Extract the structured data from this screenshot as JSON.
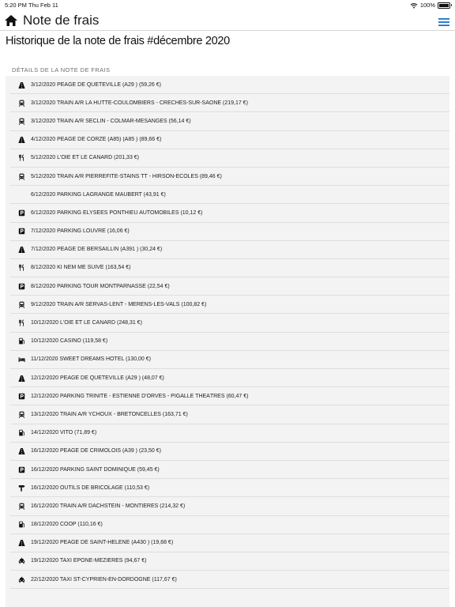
{
  "status": {
    "time": "5:20 PM",
    "date": "Thu Feb 11",
    "battery": "100%"
  },
  "nav": {
    "title": "Note de frais"
  },
  "page": {
    "title": "Historique de la note de frais #décembre 2020"
  },
  "section": {
    "label": "DÉTAILS DE LA NOTE DE FRAIS"
  },
  "items": [
    {
      "icon": "road-icon",
      "text": "3/12/2020 PÉAGE DE QUETEVILLE (A29 ) (59,26 €)"
    },
    {
      "icon": "train-icon",
      "text": "3/12/2020 TRAIN A/R LA HUTTE-COULOMBIERS - CRÈCHES-SUR-SAÔNE (219,17 €)"
    },
    {
      "icon": "train-icon",
      "text": "3/12/2020 TRAIN A/R SECLIN - COLMAR-MÉSANGES (56,14 €)"
    },
    {
      "icon": "road-icon",
      "text": "4/12/2020 PÉAGE DE CORZÉ (A85) (A85 ) (89,66 €)"
    },
    {
      "icon": "restaurant-icon",
      "text": "5/12/2020 L'OIE ET LE CANARD (201,33 €)"
    },
    {
      "icon": "train-icon",
      "text": "5/12/2020 TRAIN A/R PIERREFITE-STAINS TT - HIRSON-ÉCOLES (89,46 €)"
    },
    {
      "icon": "",
      "text": "6/12/2020 PARKING LAGRANGE MAUBERT (43,91 €)"
    },
    {
      "icon": "parking-icon",
      "text": "6/12/2020 PARKING ELYSÉES PONTHIEU AUTOMOBILES (10,12 €)"
    },
    {
      "icon": "parking-icon",
      "text": "7/12/2020 PARKING LOUVRE (16,06 €)"
    },
    {
      "icon": "road-icon",
      "text": "7/12/2020 PÉAGE DE BERSAILLIN (A391 ) (30,24 €)"
    },
    {
      "icon": "restaurant-icon",
      "text": "8/12/2020 KI NEM ME SUIVE (163,54 €)"
    },
    {
      "icon": "parking-icon",
      "text": "8/12/2020 PARKING TOUR MONTPARNASSE (22,54 €)"
    },
    {
      "icon": "train-icon",
      "text": "9/12/2020 TRAIN A/R SERVAS-LENT - MÉRENS-LES-VALS (100,82 €)"
    },
    {
      "icon": "restaurant-icon",
      "text": "10/12/2020 L'OIE ET LE CANARD (248,31 €)"
    },
    {
      "icon": "fuel-icon",
      "text": "10/12/2020 CASINO (119,58 €)"
    },
    {
      "icon": "bed-icon",
      "text": "11/12/2020 SWEET DREAMS HOTEL (130,00 €)"
    },
    {
      "icon": "road-icon",
      "text": "12/12/2020 PÉAGE DE QUETEVILLE (A29 ) (48,07 €)"
    },
    {
      "icon": "parking-icon",
      "text": "12/12/2020 PARKING TRINITÉ - ESTIENNE D'ORVES - PIGALLE THÉÂTRES (60,47 €)"
    },
    {
      "icon": "train-icon",
      "text": "13/12/2020 TRAIN A/R YCHOUX - BRETONCELLES (163,71 €)"
    },
    {
      "icon": "fuel-icon",
      "text": "14/12/2020 VITO (71,89 €)"
    },
    {
      "icon": "road-icon",
      "text": "16/12/2020 PÉAGE DE CRIMOLOIS (A39 ) (23,50 €)"
    },
    {
      "icon": "parking-icon",
      "text": "16/12/2020 PARKING SAINT DOMINIQUE (59,45 €)"
    },
    {
      "icon": "tools-icon",
      "text": "16/12/2020 OUTILS DE BRICOLAGE (110,53 €)"
    },
    {
      "icon": "train-icon",
      "text": "16/12/2020 TRAIN A/R DACHSTEIN - MONTIÈRES (214,32 €)"
    },
    {
      "icon": "fuel-icon",
      "text": "18/12/2020 COOP (110,16 €)"
    },
    {
      "icon": "road-icon",
      "text": "19/12/2020 PÉAGE DE SAINT-HÉLÈNE (A430 ) (19,68 €)"
    },
    {
      "icon": "taxi-icon",
      "text": "19/12/2020 TAXI ÉPÔNE-MÉZIÈRES (94,67 €)"
    },
    {
      "icon": "taxi-icon",
      "text": "22/12/2020 TAXI ST-CYPRIEN-EN-DORDOGNE (117,67 €)"
    }
  ],
  "colors": {
    "accent": "#1a73c9",
    "list_bg": "#f3f3f3"
  }
}
